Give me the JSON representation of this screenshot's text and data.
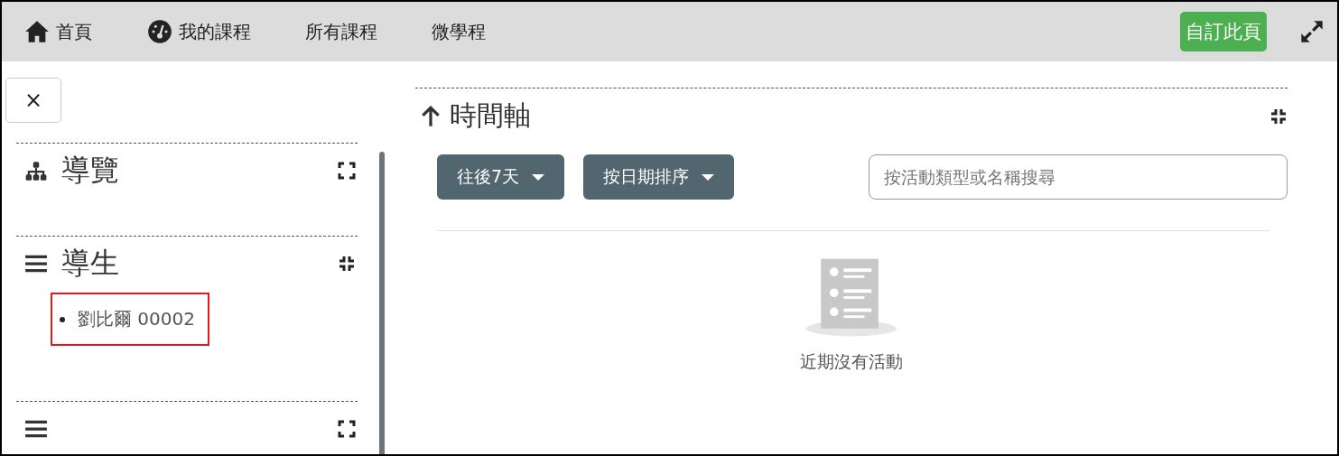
{
  "nav": {
    "items": [
      {
        "label": "首頁"
      },
      {
        "label": "我的課程"
      },
      {
        "label": "所有課程"
      },
      {
        "label": "微學程"
      }
    ],
    "customize_button": "自訂此頁"
  },
  "sidebar": {
    "close_button": "×",
    "blocks": [
      {
        "title": "導覽",
        "expanded": false
      },
      {
        "title": "導生",
        "expanded": true,
        "items": [
          {
            "label": "劉比爾 00002",
            "highlighted": true
          }
        ]
      },
      {
        "expanded": false
      }
    ]
  },
  "timeline": {
    "title": "時間軸",
    "filter_button": "往後7天",
    "sort_button": "按日期排序",
    "search": {
      "placeholder": "按活動類型或名稱搜尋"
    },
    "empty_message": "近期沒有活動"
  }
}
